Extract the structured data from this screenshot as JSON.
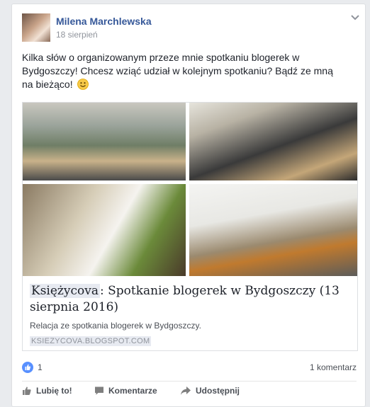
{
  "post": {
    "author": "Milena Marchlewska",
    "date": "18 sierpień",
    "text": "Kilka słów o organizowanym przeze mnie spotkaniu blogerek w Bydgoszczy! Chcesz wziąć udział w kolejnym spotkaniu? Bądź ze mną na bieżąco!"
  },
  "link": {
    "site_name": "Księżycova",
    "title_rest": ": Spotkanie blogerek w Bydgoszczy (13 sierpnia 2016)",
    "description": "Relacja ze spotkania blogerek w Bydgoszczy.",
    "domain": "KSIEZYCOVA.BLOGSPOT.COM"
  },
  "reactions": {
    "count": "1",
    "comments": "1 komentarz"
  },
  "actions": {
    "like": "Lubię to!",
    "comment": "Komentarze",
    "share": "Udostępnij"
  },
  "colors": {
    "link_blue": "#365899",
    "like_blue": "#5890ff",
    "muted": "#90949c"
  },
  "icons": [
    "chevron-down-icon",
    "smiley-icon",
    "like-thumb-icon",
    "comment-icon",
    "share-arrow-icon"
  ]
}
